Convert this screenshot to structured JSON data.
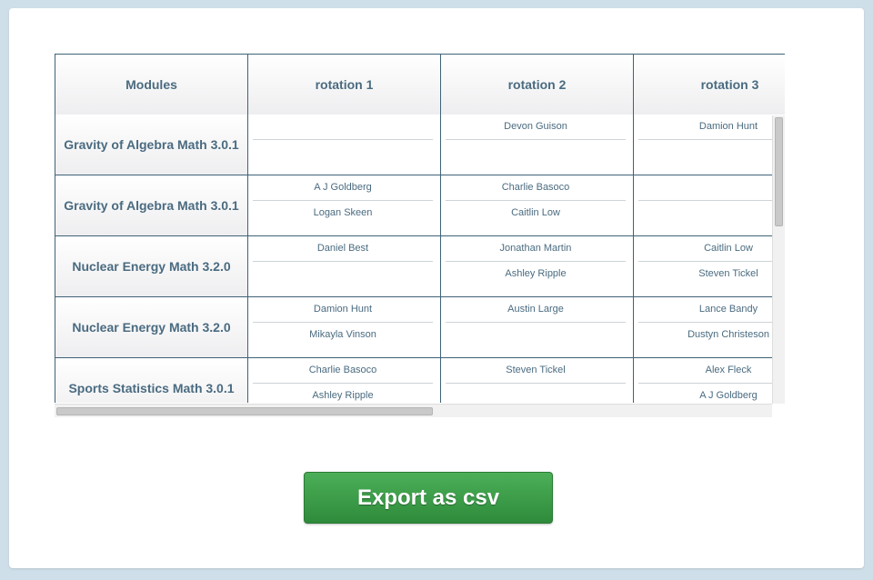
{
  "table": {
    "headers": [
      "Modules",
      "rotation 1",
      "rotation 2",
      "rotation 3"
    ],
    "rows": [
      {
        "module": "Gravity of Algebra Math 3.0.1",
        "rotations": [
          [
            "",
            ""
          ],
          [
            "Devon Guison",
            ""
          ],
          [
            "Damion Hunt",
            ""
          ]
        ]
      },
      {
        "module": "Gravity of Algebra Math 3.0.1",
        "rotations": [
          [
            "A J Goldberg",
            "Logan Skeen"
          ],
          [
            "Charlie Basoco",
            "Caitlin Low"
          ],
          [
            "",
            ""
          ]
        ]
      },
      {
        "module": "Nuclear Energy Math 3.2.0",
        "rotations": [
          [
            "Daniel Best",
            ""
          ],
          [
            "Jonathan Martin",
            "Ashley Ripple"
          ],
          [
            "Caitlin Low",
            "Steven Tickel"
          ]
        ]
      },
      {
        "module": "Nuclear Energy Math 3.2.0",
        "rotations": [
          [
            "Damion Hunt",
            "Mikayla Vinson"
          ],
          [
            "Austin Large",
            ""
          ],
          [
            "Lance Bandy",
            "Dustyn Christeson"
          ]
        ]
      },
      {
        "module": "Sports Statistics Math 3.0.1",
        "rotations": [
          [
            "Charlie Basoco",
            "Ashley Ripple"
          ],
          [
            "Steven Tickel",
            ""
          ],
          [
            "Alex Fleck",
            "A J Goldberg"
          ]
        ]
      }
    ]
  },
  "export_button": {
    "label": "Export as csv"
  },
  "colors": {
    "page_background": "#cfdfe9",
    "grid_border": "#3e6277",
    "header_text": "#4a6b80",
    "button_green": "#3a9e47"
  }
}
